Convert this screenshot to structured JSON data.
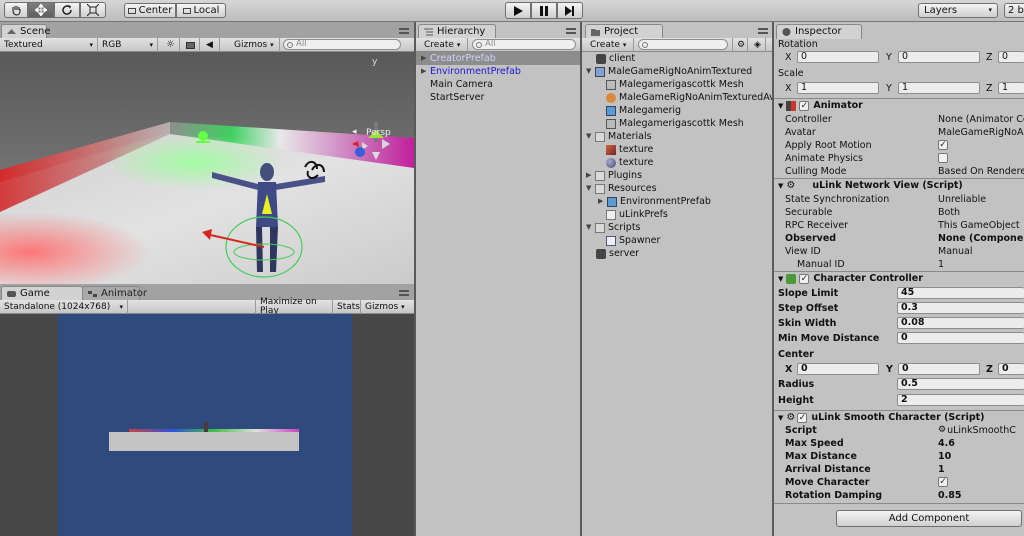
{
  "toolbar": {
    "center_label": "Center",
    "local_label": "Local",
    "layers_label": "Layers",
    "layout_label": "2 b"
  },
  "scene": {
    "tab": "Scene",
    "render_mode": "Textured",
    "color_mode": "RGB",
    "gizmos": "Gizmos",
    "search_placeholder": "All",
    "persp_label": "Persp",
    "gizmo_axis_y": "y"
  },
  "game": {
    "tab": "Game",
    "tab_animator": "Animator",
    "resolution": "Standalone (1024x768)",
    "maximize": "Maximize on Play",
    "stats": "Stats",
    "gizmos": "Gizmos"
  },
  "hierarchy": {
    "tab": "Hierarchy",
    "create": "Create",
    "search_placeholder": "All",
    "items": [
      "CreatorPrefab",
      "EnvironmentPrefab",
      "Main Camera",
      "StartServer"
    ]
  },
  "project": {
    "tab": "Project",
    "create": "Create",
    "items": [
      "client",
      "MaleGameRigNoAnimTextured",
      "Malegamerigascottk Mesh",
      "MaleGameRigNoAnimTexturedAv",
      "Malegamerig",
      "Malegamerigascottk Mesh",
      "Materials",
      "texture",
      "texture",
      "Plugins",
      "Resources",
      "EnvironmentPrefab",
      "uLinkPrefs",
      "Scripts",
      "Spawner",
      "server"
    ]
  },
  "inspector": {
    "tab": "Inspector",
    "rotation_label": "Rotation",
    "scale_label": "Scale",
    "axis_x": "X",
    "axis_y": "Y",
    "axis_z": "Z",
    "rotation": {
      "x": "0",
      "y": "0",
      "z": "0"
    },
    "scale": {
      "x": "1",
      "y": "1",
      "z": "1"
    },
    "animator": {
      "title": "Animator",
      "controller_label": "Controller",
      "controller": "None (Animator Co",
      "avatar_label": "Avatar",
      "avatar": "MaleGameRigNoAn",
      "root_motion_label": "Apply Root Motion",
      "physics_label": "Animate Physics",
      "culling_label": "Culling Mode",
      "culling": "Based On Rendere"
    },
    "ulink_view": {
      "title": "uLink Network View (Script)",
      "state_label": "State Synchronization",
      "state": "Unreliable",
      "securable_label": "Securable",
      "securable": "Both",
      "rpc_label": "RPC Receiver",
      "rpc": "This GameObject",
      "observed_label": "Observed",
      "observed": "None (Componen",
      "viewid_label": "View ID",
      "viewid": "Manual",
      "manual_label": "Manual ID",
      "manual": "1"
    },
    "character_controller": {
      "title": "Character Controller",
      "slope_label": "Slope Limit",
      "slope": "45",
      "step_label": "Step Offset",
      "step": "0.3",
      "skin_label": "Skin Width",
      "skin": "0.08",
      "minmove_label": "Min Move Distance",
      "minmove": "0",
      "center_label": "Center",
      "center": {
        "x": "0",
        "y": "0",
        "z": "0"
      },
      "radius_label": "Radius",
      "radius": "0.5",
      "height_label": "Height",
      "height": "2"
    },
    "smooth": {
      "title": "uLink Smooth Character (Script)",
      "script_label": "Script",
      "script": "uLinkSmoothC",
      "maxspeed_label": "Max Speed",
      "maxspeed": "4.6",
      "maxdist_label": "Max Distance",
      "maxdist": "10",
      "arrival_label": "Arrival Distance",
      "arrival": "1",
      "move_label": "Move Character",
      "rotdamp_label": "Rotation Damping",
      "rotdamp": "0.85"
    },
    "add_component": "Add Component"
  }
}
